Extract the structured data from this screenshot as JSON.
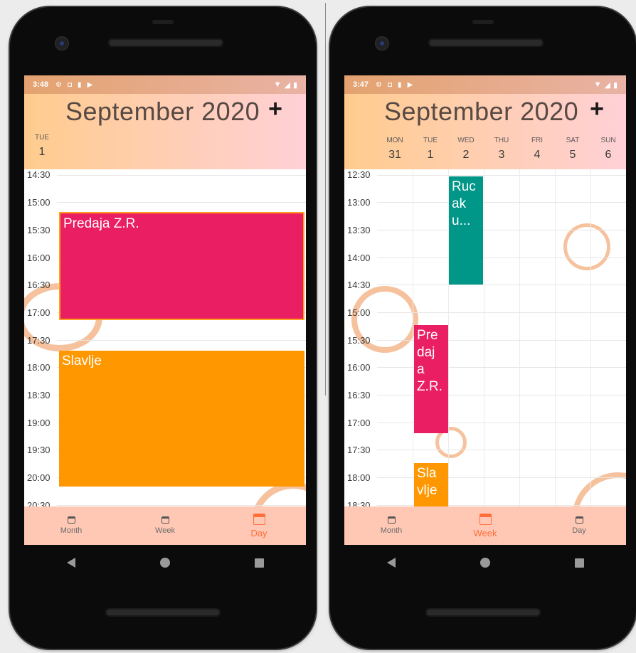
{
  "left": {
    "status": {
      "time": "3:48",
      "icons": [
        "⚙",
        "◘",
        "▮",
        "▶"
      ],
      "right": [
        "▼",
        "◢",
        "▮"
      ]
    },
    "header": {
      "title": "September 2020",
      "add": "+",
      "day": {
        "name": "TUE",
        "num": "1"
      }
    },
    "times": [
      "14:30",
      "15:00",
      "15:30",
      "16:00",
      "16:30",
      "17:00",
      "17:30",
      "18:00",
      "18:30",
      "19:00",
      "19:30",
      "20:00",
      "20:30"
    ],
    "events": [
      {
        "title": "Predaja Z.R.",
        "color": "#e91e63"
      },
      {
        "title": "Slavlje",
        "color": "#ff9800"
      }
    ],
    "nav": [
      {
        "label": "Month",
        "active": false
      },
      {
        "label": "Week",
        "active": false
      },
      {
        "label": "Day",
        "active": true
      }
    ]
  },
  "right": {
    "status": {
      "time": "3:47",
      "icons": [
        "⚙",
        "◘",
        "▮",
        "▶"
      ],
      "right": [
        "▼",
        "◢",
        "▮"
      ]
    },
    "header": {
      "title": "September 2020",
      "add": "+",
      "days": [
        {
          "name": "MON",
          "num": "31"
        },
        {
          "name": "TUE",
          "num": "1"
        },
        {
          "name": "WED",
          "num": "2"
        },
        {
          "name": "THU",
          "num": "3"
        },
        {
          "name": "FRI",
          "num": "4"
        },
        {
          "name": "SAT",
          "num": "5"
        },
        {
          "name": "SUN",
          "num": "6"
        }
      ]
    },
    "times": [
      "12:30",
      "13:00",
      "13:30",
      "14:00",
      "14:30",
      "15:00",
      "15:30",
      "16:00",
      "16:30",
      "17:00",
      "17:30",
      "18:00",
      "18:30"
    ],
    "events": [
      {
        "title": "Ruc\nak\nu...",
        "color": "#009688"
      },
      {
        "title": "Pre\ndaj\na\nZ.R.",
        "color": "#e91e63"
      },
      {
        "title": "Sla\nvlje",
        "color": "#ff9800"
      }
    ],
    "nav": [
      {
        "label": "Month",
        "active": false
      },
      {
        "label": "Week",
        "active": true
      },
      {
        "label": "Day",
        "active": false
      }
    ]
  },
  "colors": {
    "ring": "#f6c29e",
    "accent": "#ff6d3a",
    "nav_bg": "#ffc8b5"
  }
}
